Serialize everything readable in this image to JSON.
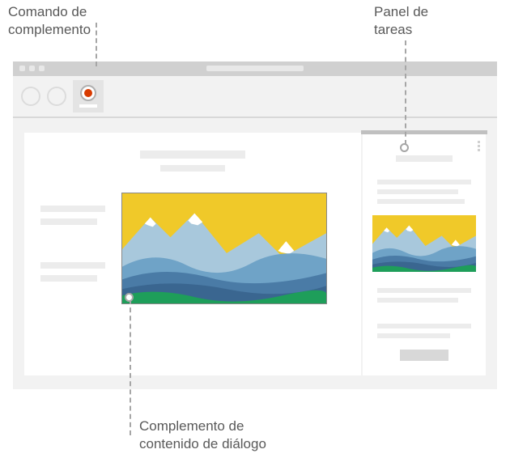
{
  "labels": {
    "addin_command": "Comando de\ncomplemento",
    "task_pane": "Panel de\ntareas",
    "content_dialog": "Complemento de\ncontenido de diálogo"
  },
  "colors": {
    "accent_red": "#d83b01",
    "sky": "#f0c929",
    "mountain_far": "#a8c8dc",
    "mountain_mid": "#6fa3c7",
    "mountain_near": "#4a7ba6",
    "hills": "#3a6690",
    "grass": "#1e9e5a",
    "sun": "#e74c1c",
    "snow": "#ffffff"
  }
}
